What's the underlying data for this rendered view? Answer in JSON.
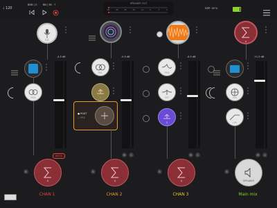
{
  "topbar": {
    "tempo": "♩ 120",
    "position_line1": "BDB | 2 ·",
    "position_line2": "BB | 36 · 7",
    "meter_title": "SPEAKER OUT",
    "meter_scale": [
      "-96",
      "-48",
      "-36",
      "-24",
      "-12",
      "-6",
      "-3",
      "0"
    ],
    "meter_level_l": 0.02,
    "meter_level_r": 0.02,
    "dsp": "DSP: 18 %",
    "battery_level": 0.85
  },
  "channels": [
    {
      "name": "CHAN 1",
      "name_color": "#e0453a",
      "src_label": "MIC",
      "fx_label": "PAN",
      "db": "-4.5 dB",
      "fader": 0.55,
      "mute_label": "MUTE",
      "send_label": "A"
    },
    {
      "name": "CHAN 2",
      "name_color": "#e89a2a",
      "src_label": "",
      "fx1_label": "BAL",
      "fx2_label": "R",
      "db": "-0.5 dB",
      "fader": 0.55,
      "send_label": "A",
      "post_label": "POST",
      "pre_label": "PRE"
    },
    {
      "name": "CHAN 3",
      "name_color": "#e8c830",
      "fx1_label": "PAN",
      "fx2_label": "OFF",
      "fx3_label": "G",
      "db": "-6.5 dB",
      "fader": 0.6,
      "send_label": "A"
    },
    {
      "name": "Main mix",
      "name_color": "#8dd12e",
      "src_label": "A",
      "fx1_label": "M/S",
      "fx2_label": "LIM",
      "db": "+1.5 dB",
      "fader": 0.78,
      "out_label": "SPEAKER"
    }
  ],
  "colors": {
    "red": "#d5303b",
    "orange": "#e89a2a",
    "purple": "#6a4bd6",
    "accent": "#e0453a"
  }
}
